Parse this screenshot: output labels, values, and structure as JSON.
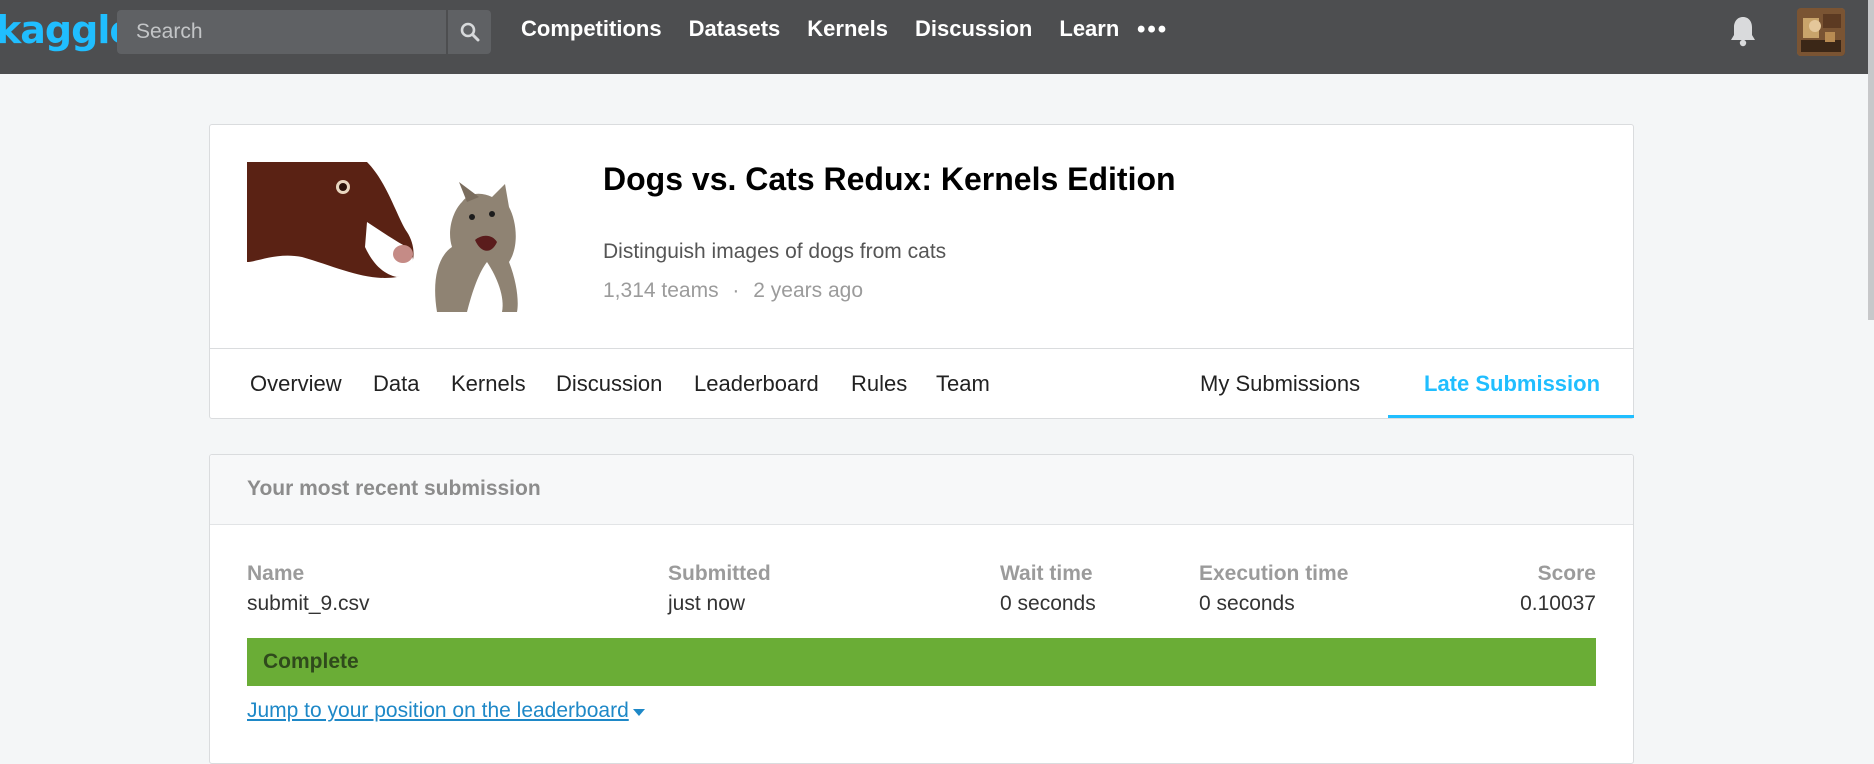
{
  "app": {
    "logo": "kaggle",
    "search_placeholder": "Search",
    "nav": [
      "Competitions",
      "Datasets",
      "Kernels",
      "Discussion",
      "Learn"
    ],
    "more_label": "•••",
    "icons": {
      "search": "search-icon",
      "bell": "bell-icon",
      "more": "more-icon"
    }
  },
  "competition": {
    "title": "Dogs vs. Cats Redux: Kernels Edition",
    "subtitle": "Distinguish images of dogs from cats",
    "teams": "1,314 teams",
    "separator": "·",
    "age": "2 years ago"
  },
  "tabs": {
    "left": [
      "Overview",
      "Data",
      "Kernels",
      "Discussion",
      "Leaderboard",
      "Rules",
      "Team"
    ],
    "my_submissions": "My Submissions",
    "late_submission": "Late Submission",
    "active": "Late Submission"
  },
  "submission": {
    "header": "Your most recent submission",
    "columns": {
      "name": "Name",
      "submitted": "Submitted",
      "wait": "Wait time",
      "execution": "Execution time",
      "score": "Score"
    },
    "values": {
      "name": "submit_9.csv",
      "submitted": "just now",
      "wait": "0 seconds",
      "execution": "0 seconds",
      "score": "0.10037"
    },
    "status": "Complete",
    "jump_link": "Jump to your position on the leaderboard"
  },
  "colors": {
    "accent": "#20beff",
    "nav_bg": "#4d4e50",
    "complete": "#6aad36",
    "link": "#1e88c7"
  }
}
